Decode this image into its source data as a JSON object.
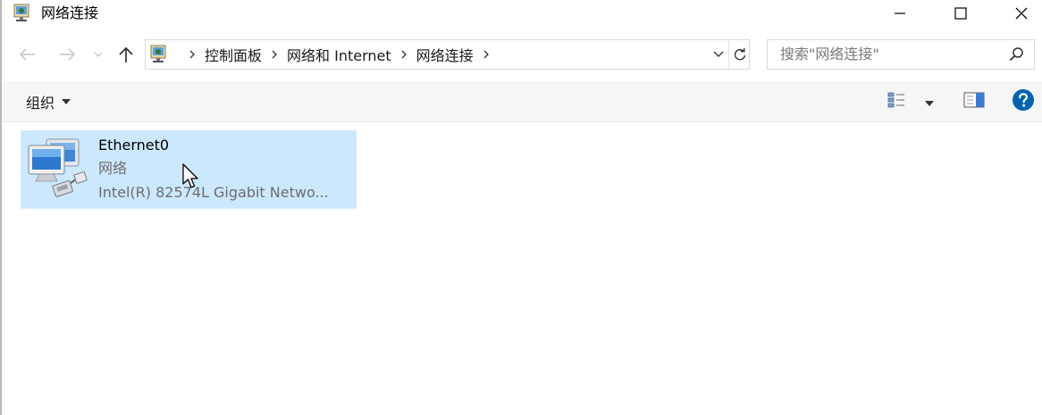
{
  "window": {
    "title": "网络连接",
    "minimize_label": "—",
    "maximize_label": "☐",
    "close_label": "✕"
  },
  "navigation": {
    "breadcrumbs": [
      "控制面板",
      "网络和 Internet",
      "网络连接"
    ],
    "search_placeholder": "搜索\"网络连接\""
  },
  "command_bar": {
    "organize_label": "组织"
  },
  "content": {
    "items": [
      {
        "name": "Ethernet0",
        "status": "网络",
        "description": "Intel(R) 82574L Gigabit Netwo...",
        "selected": true
      }
    ]
  },
  "colors": {
    "selection": "#cce8ff",
    "help_blue": "#0063b1",
    "command_bar_bg": "#f5f6f7"
  },
  "icons": {
    "title": "network-connections-icon",
    "help": "help-icon",
    "item": "ethernet-adapter-icon"
  }
}
